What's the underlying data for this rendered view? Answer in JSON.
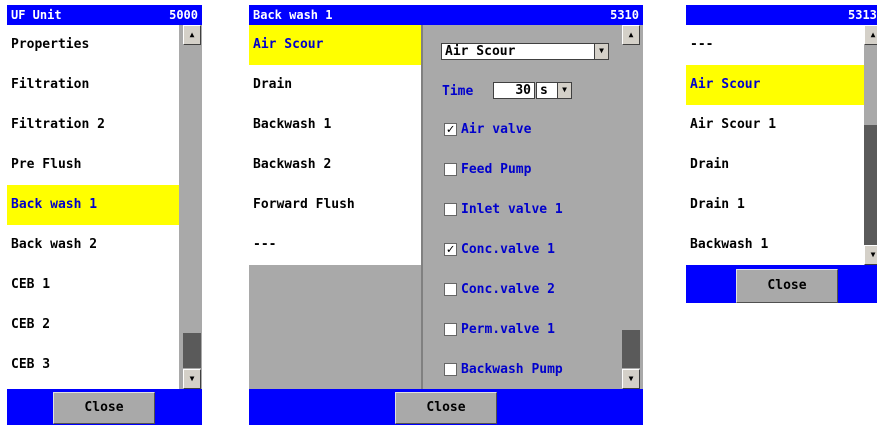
{
  "panel1": {
    "title": "UF Unit",
    "code": "5000",
    "items": [
      "Properties",
      "Filtration",
      "Filtration 2",
      "Pre Flush",
      "Back wash 1",
      "Back wash 2",
      "CEB 1",
      "CEB 2",
      "CEB 3"
    ],
    "selected_index": 4,
    "close_label": "Close"
  },
  "panel2": {
    "title": "Back wash 1",
    "code": "5310",
    "steps": [
      "Air Scour",
      "Drain",
      "Backwash 1",
      "Backwash 2",
      "Forward Flush",
      "---"
    ],
    "selected_index": 0,
    "step_select_value": "Air Scour",
    "time_label": "Time",
    "time_value": "30",
    "time_unit": "s",
    "options": [
      {
        "label": "Air valve",
        "checked": true
      },
      {
        "label": "Feed Pump",
        "checked": false
      },
      {
        "label": "Inlet valve 1",
        "checked": false
      },
      {
        "label": "Conc.valve 1",
        "checked": true
      },
      {
        "label": "Conc.valve 2",
        "checked": false
      },
      {
        "label": "Perm.valve 1",
        "checked": false
      },
      {
        "label": "Backwash Pump",
        "checked": false
      }
    ],
    "close_label": "Close"
  },
  "panel3": {
    "code": "5313",
    "items": [
      "---",
      "Air Scour",
      "Air Scour 1",
      "Drain",
      "Drain 1",
      "Backwash 1"
    ],
    "selected_index": 1,
    "close_label": "Close"
  },
  "colors": {
    "title_bar": "#0000ff",
    "selection": "#ffff00",
    "panel_bg": "#a9a9a9",
    "option_text": "#0000cc"
  }
}
